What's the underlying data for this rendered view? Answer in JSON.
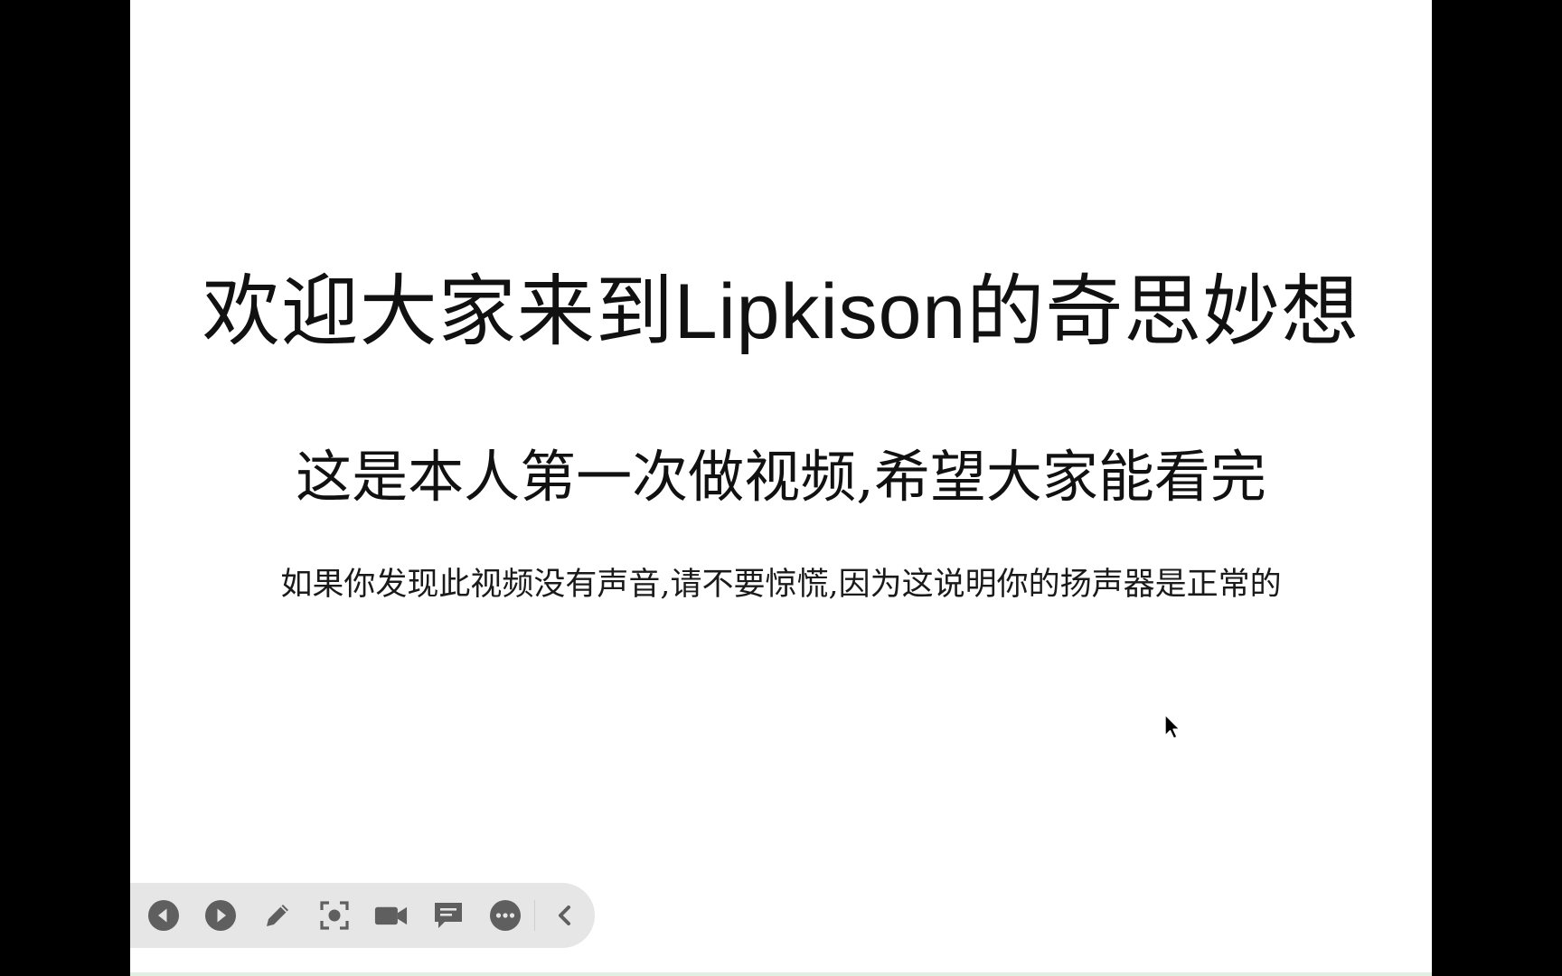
{
  "slide": {
    "title_part1": "欢迎大家来到",
    "title_latin": "Lipkison",
    "title_part2": "的奇思妙想",
    "subtitle": "这是本人第一次做视频,希望大家能看完",
    "note": "如果你发现此视频没有声音,请不要惊慌,因为这说明你的扬声器是正常的"
  },
  "toolbar": {
    "buttons": [
      {
        "icon": "previous-icon"
      },
      {
        "icon": "next-icon"
      },
      {
        "icon": "pen-icon"
      },
      {
        "icon": "screenshot-icon"
      },
      {
        "icon": "camera-icon"
      },
      {
        "icon": "comment-icon"
      },
      {
        "icon": "more-icon"
      },
      {
        "icon": "collapse-chevron-icon"
      }
    ]
  },
  "colors": {
    "background": "#000000",
    "slide": "#ffffff",
    "text": "#111111",
    "toolbar": "#e6e6e6",
    "icon": "#5f5f5f"
  }
}
